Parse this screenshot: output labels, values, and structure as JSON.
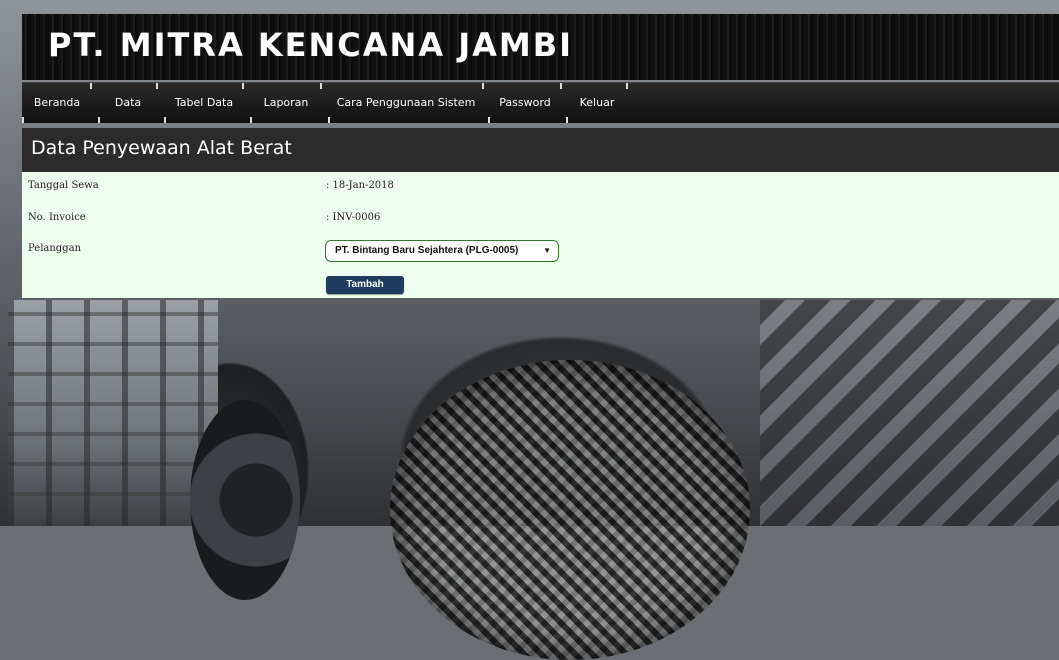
{
  "header": {
    "site_title": "PT. MITRA KENCANA JAMBI"
  },
  "nav": {
    "items": [
      {
        "label": "Beranda"
      },
      {
        "label": "Data"
      },
      {
        "label": "Tabel Data"
      },
      {
        "label": "Laporan"
      },
      {
        "label": "Cara Penggunaan Sistem"
      },
      {
        "label": "Password"
      },
      {
        "label": "Keluar"
      }
    ]
  },
  "page": {
    "title": "Data Penyewaan Alat Berat"
  },
  "form": {
    "tanggal_label": "Tanggal Sewa",
    "tanggal_value": ": 18-Jan-2018",
    "invoice_label": "No. Invoice",
    "invoice_value": ": INV-0006",
    "pelanggan_label": "Pelanggan",
    "pelanggan_selected": "PT. Bintang Baru Sejahtera (PLG-0005)",
    "submit_label": "Tambah"
  }
}
